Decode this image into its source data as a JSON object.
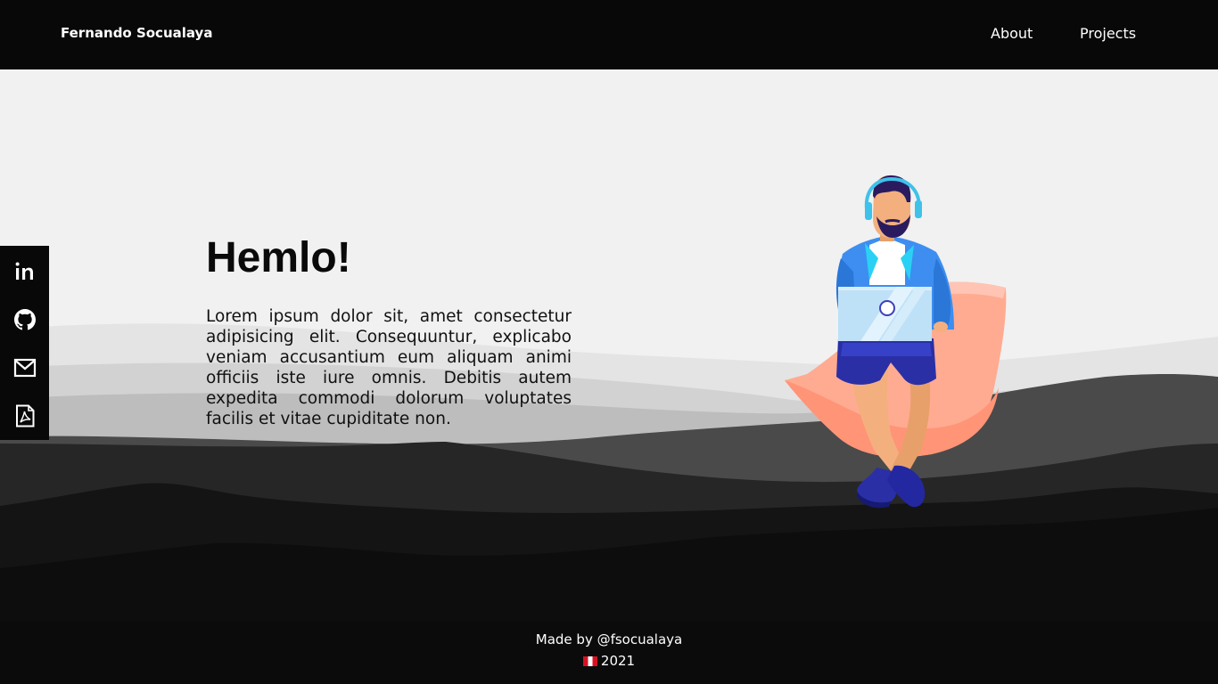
{
  "navbar": {
    "brand": "Fernando Socualaya",
    "links": [
      {
        "label": "About"
      },
      {
        "label": "Projects"
      }
    ]
  },
  "social": {
    "items": [
      {
        "icon": "linkedin-icon"
      },
      {
        "icon": "github-icon"
      },
      {
        "icon": "email-icon"
      },
      {
        "icon": "pdf-icon"
      }
    ]
  },
  "hero": {
    "title": "Hemlo!",
    "text": "Lorem ipsum dolor sit, amet consectetur adipisicing elit. Consequuntur, explicabo veniam accusantium eum aliquam animi officiis iste iure omnis. Debitis autem expedita commodi dolorum voluptates facilis et vitae cupiditate non."
  },
  "footer": {
    "credit": "Made by @fsocualaya",
    "year": "2021"
  },
  "colors": {
    "navbar_bg": "#080808",
    "page_bg": "#f1f1f1",
    "chair": "#ffab91",
    "jacket": "#3d8ef0",
    "shorts": "#2a2fa6"
  }
}
